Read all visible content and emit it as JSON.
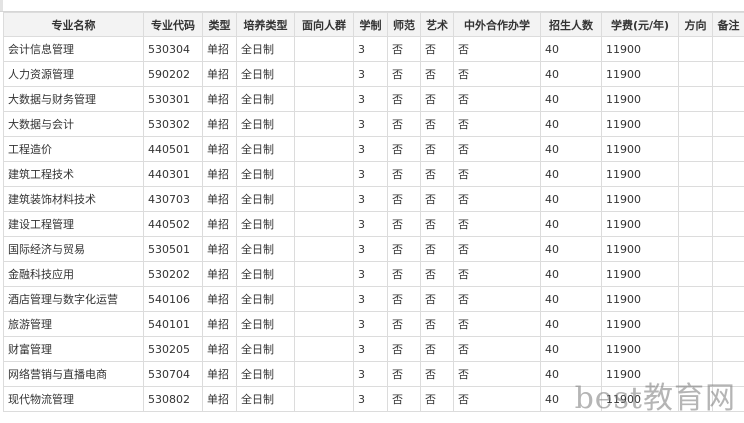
{
  "table": {
    "headers": [
      "专业名称",
      "专业代码",
      "类型",
      "培养类型",
      "面向人群",
      "学制",
      "师范",
      "艺术",
      "中外合作办学",
      "招生人数",
      "学费(元/年)",
      "方向",
      "备注"
    ],
    "rows": [
      [
        "会计信息管理",
        "530304",
        "单招",
        "全日制",
        "",
        "3",
        "否",
        "否",
        "否",
        "40",
        "11900",
        "",
        ""
      ],
      [
        "人力资源管理",
        "590202",
        "单招",
        "全日制",
        "",
        "3",
        "否",
        "否",
        "否",
        "40",
        "11900",
        "",
        ""
      ],
      [
        "大数据与财务管理",
        "530301",
        "单招",
        "全日制",
        "",
        "3",
        "否",
        "否",
        "否",
        "40",
        "11900",
        "",
        ""
      ],
      [
        "大数据与会计",
        "530302",
        "单招",
        "全日制",
        "",
        "3",
        "否",
        "否",
        "否",
        "40",
        "11900",
        "",
        ""
      ],
      [
        "工程造价",
        "440501",
        "单招",
        "全日制",
        "",
        "3",
        "否",
        "否",
        "否",
        "40",
        "11900",
        "",
        ""
      ],
      [
        "建筑工程技术",
        "440301",
        "单招",
        "全日制",
        "",
        "3",
        "否",
        "否",
        "否",
        "40",
        "11900",
        "",
        ""
      ],
      [
        "建筑装饰材料技术",
        "430703",
        "单招",
        "全日制",
        "",
        "3",
        "否",
        "否",
        "否",
        "40",
        "11900",
        "",
        ""
      ],
      [
        "建设工程管理",
        "440502",
        "单招",
        "全日制",
        "",
        "3",
        "否",
        "否",
        "否",
        "40",
        "11900",
        "",
        ""
      ],
      [
        "国际经济与贸易",
        "530501",
        "单招",
        "全日制",
        "",
        "3",
        "否",
        "否",
        "否",
        "40",
        "11900",
        "",
        ""
      ],
      [
        "金融科技应用",
        "530202",
        "单招",
        "全日制",
        "",
        "3",
        "否",
        "否",
        "否",
        "40",
        "11900",
        "",
        ""
      ],
      [
        "酒店管理与数字化运营",
        "540106",
        "单招",
        "全日制",
        "",
        "3",
        "否",
        "否",
        "否",
        "40",
        "11900",
        "",
        ""
      ],
      [
        "旅游管理",
        "540101",
        "单招",
        "全日制",
        "",
        "3",
        "否",
        "否",
        "否",
        "40",
        "11900",
        "",
        ""
      ],
      [
        "财富管理",
        "530205",
        "单招",
        "全日制",
        "",
        "3",
        "否",
        "否",
        "否",
        "40",
        "11900",
        "",
        ""
      ],
      [
        "网络营销与直播电商",
        "530704",
        "单招",
        "全日制",
        "",
        "3",
        "否",
        "否",
        "否",
        "40",
        "11900",
        "",
        ""
      ],
      [
        "现代物流管理",
        "530802",
        "单招",
        "全日制",
        "",
        "3",
        "否",
        "否",
        "否",
        "40",
        "11900",
        "",
        ""
      ]
    ]
  },
  "watermark": "best教育网",
  "colors": {
    "header_bg": "#f3f3f3",
    "border": "#dcdcdc",
    "text": "#333333"
  }
}
